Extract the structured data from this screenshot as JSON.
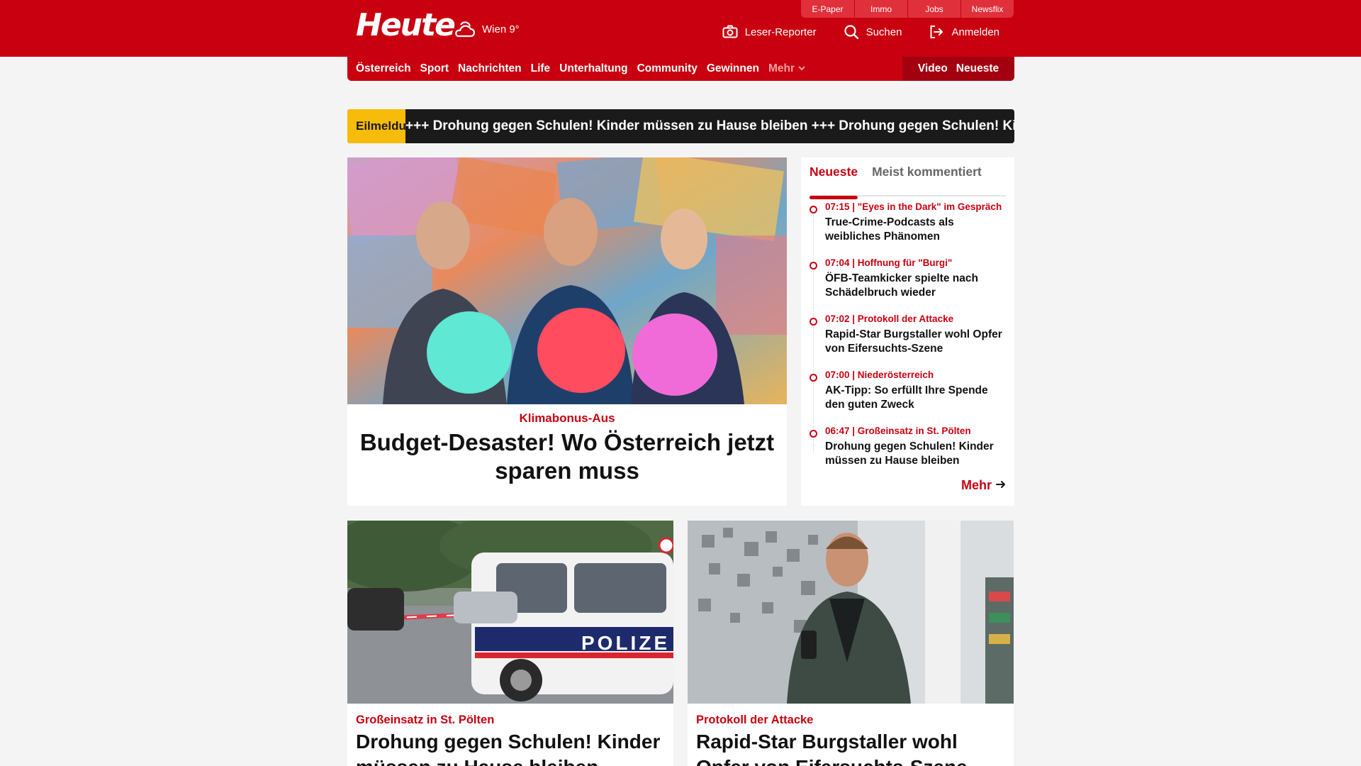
{
  "header": {
    "logo": "Heute",
    "weather": "Wien 9°",
    "service_tabs": [
      "E-Paper",
      "Immo",
      "Jobs",
      "Newsflix"
    ],
    "actions": [
      "Leser-Reporter",
      "Suchen",
      "Anmelden"
    ]
  },
  "nav": {
    "items": [
      "Österreich",
      "Sport",
      "Nachrichten",
      "Life",
      "Unterhaltung",
      "Community",
      "Gewinnen"
    ],
    "more": "Mehr",
    "right": [
      "Video",
      "Neueste"
    ]
  },
  "breaking": {
    "label": "Eilmeldung",
    "text": "+++  Drohung gegen Schulen! Kinder müssen zu Hause bleiben  +++  Drohung gegen Schulen! Kinder müssen zu Hause bleiben"
  },
  "hero": {
    "kicker": "Klimabonus-Aus",
    "title": "Budget-Desaster! Wo Österreich jetzt sparen muss"
  },
  "sidebar": {
    "tabs": [
      "Neueste",
      "Meist kommentiert"
    ],
    "items": [
      {
        "meta": "07:15 | \"Eyes in the Dark\" im Gespräch",
        "headline": "True-Crime-Podcasts als weibliches Phänomen"
      },
      {
        "meta": "07:04 | Hoffnung für \"Burgi\"",
        "headline": "ÖFB-Teamkicker spielte nach Schädelbruch wieder"
      },
      {
        "meta": "07:02 | Protokoll der Attacke",
        "headline": "Rapid-Star Burgstaller wohl Opfer von Eifersuchts-Szene"
      },
      {
        "meta": "07:00 | Niederösterreich",
        "headline": "AK-Tipp: So erfüllt Ihre Spende den guten Zweck"
      },
      {
        "meta": "06:47 | Großeinsatz in St. Pölten",
        "headline": "Drohung gegen Schulen! Kinder müssen zu Hause bleiben"
      }
    ],
    "more": "Mehr"
  },
  "cards": [
    {
      "kicker": "Großeinsatz in St. Pölten",
      "title": "Drohung gegen Schulen! Kinder müssen zu Hause bleiben",
      "image_text": "POLIZE"
    },
    {
      "kicker": "Protokoll der Attacke",
      "title": "Rapid-Star Burgstaller wohl Opfer von Eifersuchts-Szene"
    }
  ],
  "colors": {
    "brand_red": "#c8000f",
    "breaking_yellow": "#f7bb0a",
    "ticker_dark": "#1a1a1a"
  }
}
